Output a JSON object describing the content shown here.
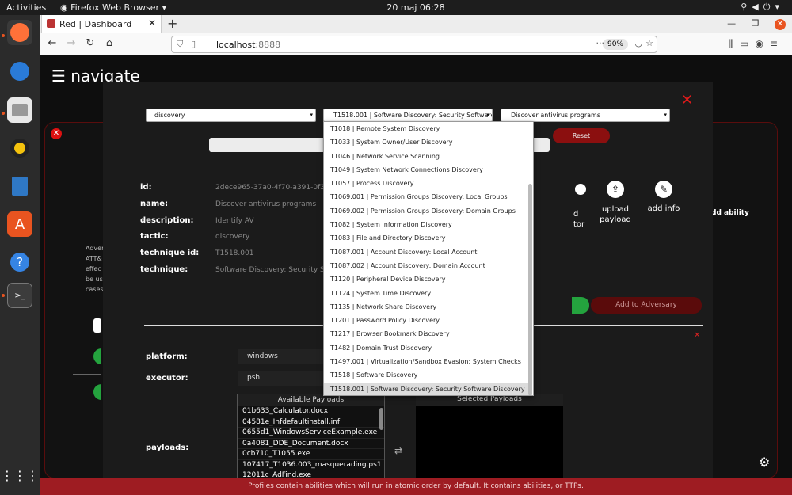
{
  "os": {
    "activities": "Activities",
    "app_name": "Firefox Web Browser",
    "clock": "20 maj  06:28"
  },
  "browser": {
    "tab_title": "Red | Dashboard",
    "url_host": "localhost",
    "url_port": ":8888",
    "zoom": "90%"
  },
  "page": {
    "nav_title": "☰ navigate",
    "bg_description": "Adver\nATT&\neffec\nbe us\ncases",
    "bg_tab_label": "dd ability",
    "footer": "Profiles contain abilities which will run in atomic order by default. It contains abilities, or TTPs."
  },
  "modal": {
    "tactic_select": "discovery",
    "technique_select": "T1518.001 | Software Discovery: Security Software Discovery",
    "ability_select": "Discover antivirus programs",
    "reset_label": "Reset",
    "details": {
      "id_label": "id:",
      "id_value": "2dece965-37a0-4f70-a391-0f30",
      "name_label": "name:",
      "name_value": "Discover antivirus programs",
      "description_label": "description:",
      "description_value": "Identify AV",
      "tactic_label": "tactic:",
      "tactic_value": "discovery",
      "technique_id_label": "technique id:",
      "technique_id_value": "T1518.001",
      "technique_label": "technique:",
      "technique_value": "Software Discovery: Security So"
    },
    "actions": {
      "partial_label": "d\ntor",
      "upload_payload": "upload\npayload",
      "add_info": "add info"
    },
    "add_to_adversary": "Add to Adversary",
    "platform_label": "platform:",
    "platform_value": "windows",
    "executor_label": "executor:",
    "executor_value": "psh",
    "payloads_label": "payloads:",
    "available_payloads_title": "Available Payloads",
    "selected_payloads_title": "Selected Payloads",
    "available_payloads": [
      "01b633_Calculator.docx",
      "04581e_Infdefaultinstall.inf",
      "0655d1_WindowsServiceExample.exe",
      "0a4081_DDE_Document.docx",
      "0cb710_T1055.exe",
      "107417_T1036.003_masquerading.ps1",
      "12011c_AdFind.exe"
    ]
  },
  "dropdown": {
    "items": [
      "T1018 | Remote System Discovery",
      "T1033 | System Owner/User Discovery",
      "T1046 | Network Service Scanning",
      "T1049 | System Network Connections Discovery",
      "T1057 | Process Discovery",
      "T1069.001 | Permission Groups Discovery: Local Groups",
      "T1069.002 | Permission Groups Discovery: Domain Groups",
      "T1082 | System Information Discovery",
      "T1083 | File and Directory Discovery",
      "T1087.001 | Account Discovery: Local Account",
      "T1087.002 | Account Discovery: Domain Account",
      "T1120 | Peripheral Device Discovery",
      "T1124 | System Time Discovery",
      "T1135 | Network Share Discovery",
      "T1201 | Password Policy Discovery",
      "T1217 | Browser Bookmark Discovery",
      "T1482 | Domain Trust Discovery",
      "T1497.001 | Virtualization/Sandbox Evasion: System Checks",
      "T1518 | Software Discovery",
      "T1518.001 | Software Discovery: Security Software Discovery"
    ],
    "active_index": 19
  },
  "colors": {
    "accent_red": "#9e1c22",
    "close_red": "#e01b1b",
    "green": "#24a33e"
  }
}
